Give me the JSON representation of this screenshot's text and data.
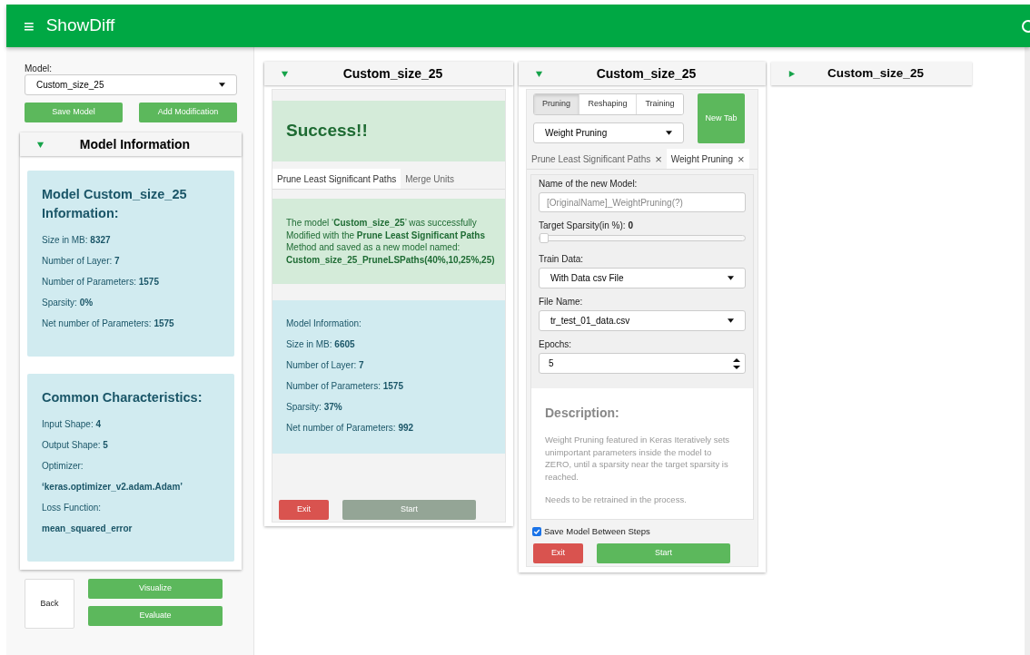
{
  "app_bar": {
    "menu_glyph": "≡",
    "title": "ShowDiff"
  },
  "sidebar": {
    "model_label": "Model:",
    "model_value": "Custom_size_25",
    "buttons": [
      "Save Model",
      "Add Modification"
    ],
    "info_panel": {
      "title": "Model Information",
      "expanded": true,
      "cards": [
        {
          "title": "Model Custom_size_25 Information:",
          "rows": [
            {
              "label": "Size in MB:",
              "value": "8327"
            },
            {
              "label": "Number of Layer:",
              "value": "7"
            },
            {
              "label": "Number of Parameters:",
              "value": "1575"
            },
            {
              "label": "Sparsity:",
              "value": "0%"
            },
            {
              "label": "Net number of Parameters:",
              "value": "1575"
            }
          ]
        },
        {
          "title": "Common Characteristics:",
          "rows": [
            {
              "label": "Input Shape:",
              "value": "4"
            },
            {
              "label": "Output Shape:",
              "value": "5"
            },
            {
              "label": "Optimizer:"
            },
            {
              "value": "‘keras.optimizer_v2.adam.Adam’"
            },
            {
              "label": "Loss Function:"
            },
            {
              "value": "mean_squared_error"
            }
          ]
        }
      ]
    },
    "back_button": "Back",
    "actions": [
      "Visualize",
      "Evaluate"
    ]
  },
  "panels": [
    {
      "kind": "result",
      "title": "Custom_size_25",
      "expanded": true,
      "success": "Success!!",
      "tabs": [
        {
          "label": "Prune Least Significant Paths",
          "selected": true
        },
        {
          "label": "Merge Units",
          "selected": false
        }
      ],
      "message": "The model ‘**Custom_size_25**’ was successfully Modified with the **Prune Least Significant Paths** Method and saved as a new model named: **Custom_size_25_PruneLSPaths(40%,10,25%,25)**",
      "info_title": "Model Information:",
      "info_rows": [
        {
          "label": "Size in MB:",
          "value": "6605"
        },
        {
          "label": "Number of Layer:",
          "value": "7"
        },
        {
          "label": "Number of Parameters:",
          "value": "1575"
        },
        {
          "label": "Sparsity:",
          "value": "37%"
        },
        {
          "label": "Net number of Parameters:",
          "value": "992"
        }
      ],
      "exit": "Exit",
      "start": {
        "label": "Start",
        "disabled": true
      }
    },
    {
      "kind": "modify",
      "title": "Custom_size_25",
      "expanded": true,
      "categories": [
        {
          "label": "Pruning",
          "selected": true
        },
        {
          "label": "Reshaping",
          "selected": false
        },
        {
          "label": "Training",
          "selected": false
        }
      ],
      "method": "Weight Pruning",
      "new_tab": "New Tab",
      "tabs": [
        {
          "label": "Prune Least Significant Paths",
          "close": "×",
          "selected": false
        },
        {
          "label": "Weight Pruning",
          "close": "×",
          "selected": true
        }
      ],
      "name_label": "Name of the new Model:",
      "name_placeholder": "[OriginalName]_WeightPruning(?)",
      "sparsity_label": "Target Sparsity(in %):",
      "sparsity_value": "0",
      "sparsity": {
        "level": 0
      },
      "train_label": "Train Data:",
      "train_value": "With Data csv File",
      "file_label": "File Name:",
      "file_value": "tr_test_01_data.csv",
      "epochs_label": "Epochs:",
      "epochs_value": "5",
      "description_title": "Description:",
      "description": [
        "Weight Pruning featured in Keras Iteratively sets unimportant parameters inside the model to ZERO, until a sparsity near the target sparsity is reached.",
        "Needs to be retrained in the process."
      ],
      "save_between": {
        "label": "Save Model Between Steps",
        "checked": true
      },
      "exit": "Exit",
      "start": {
        "label": "Start",
        "disabled": false
      }
    },
    {
      "kind": "collapsed",
      "title": "Custom_size_25",
      "expanded": false
    }
  ]
}
